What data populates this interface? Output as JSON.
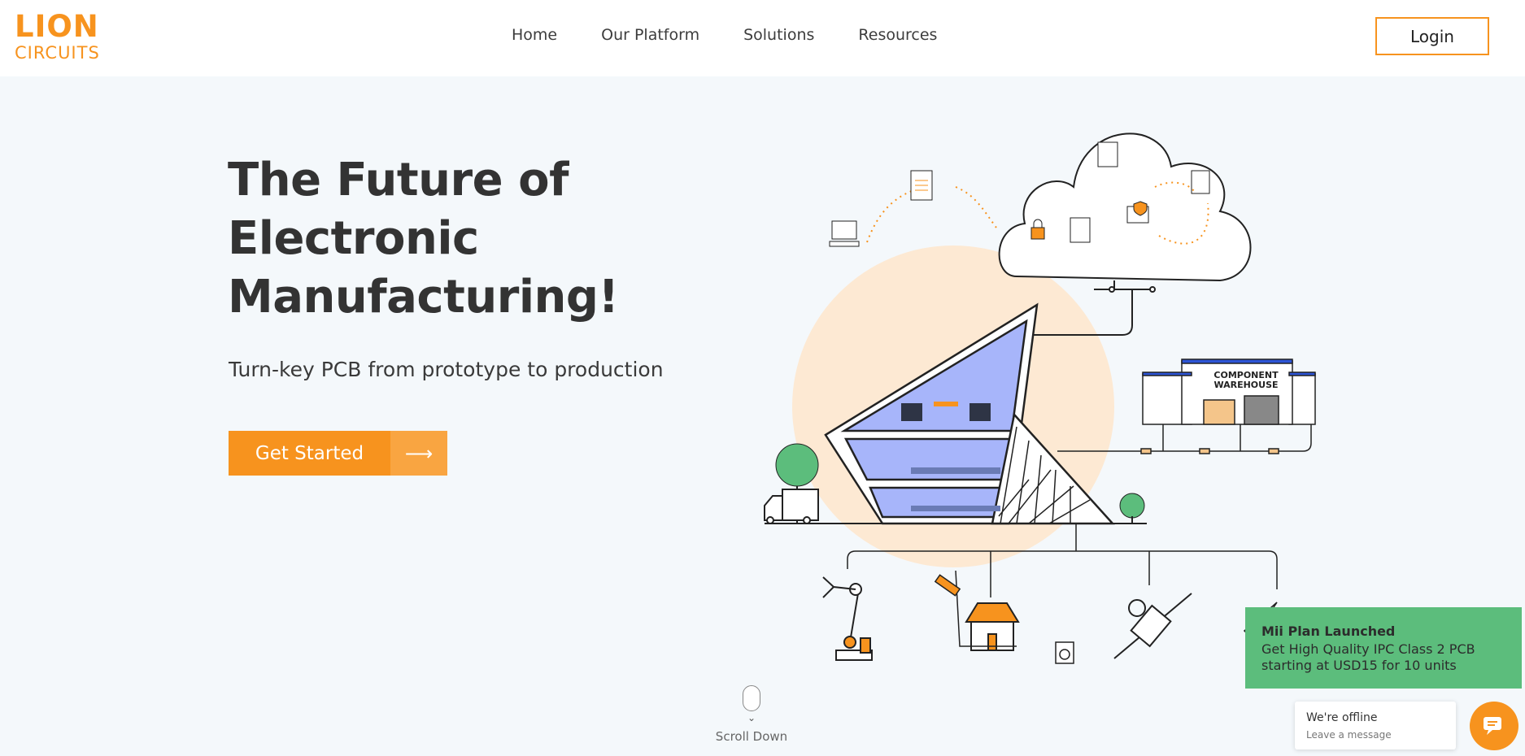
{
  "logo": {
    "line1": "LION",
    "line2": "CIRCUITS"
  },
  "nav": {
    "items": [
      "Home",
      "Our Platform",
      "Solutions",
      "Resources"
    ]
  },
  "header": {
    "login_label": "Login"
  },
  "hero": {
    "title": "The Future of Electronic Manufacturing!",
    "subtitle": "Turn-key PCB from prototype to production",
    "cta_label": "Get Started",
    "cta_arrow": "⟶"
  },
  "illustration": {
    "warehouse_sign": [
      "COMPONENT",
      "WAREHOUSE"
    ]
  },
  "scroll": {
    "label": "Scroll Down"
  },
  "promo": {
    "title": "Mii Plan Launched",
    "text": "Get High Quality IPC Class 2 PCB starting at USD15 for 10 units"
  },
  "chat": {
    "title": "We're offline",
    "subtitle": "Leave a message"
  },
  "colors": {
    "accent": "#f7931e",
    "promo_bg": "#5cbd7c",
    "building_glass": "#a7b5fa",
    "sun": "#fde9d3"
  }
}
